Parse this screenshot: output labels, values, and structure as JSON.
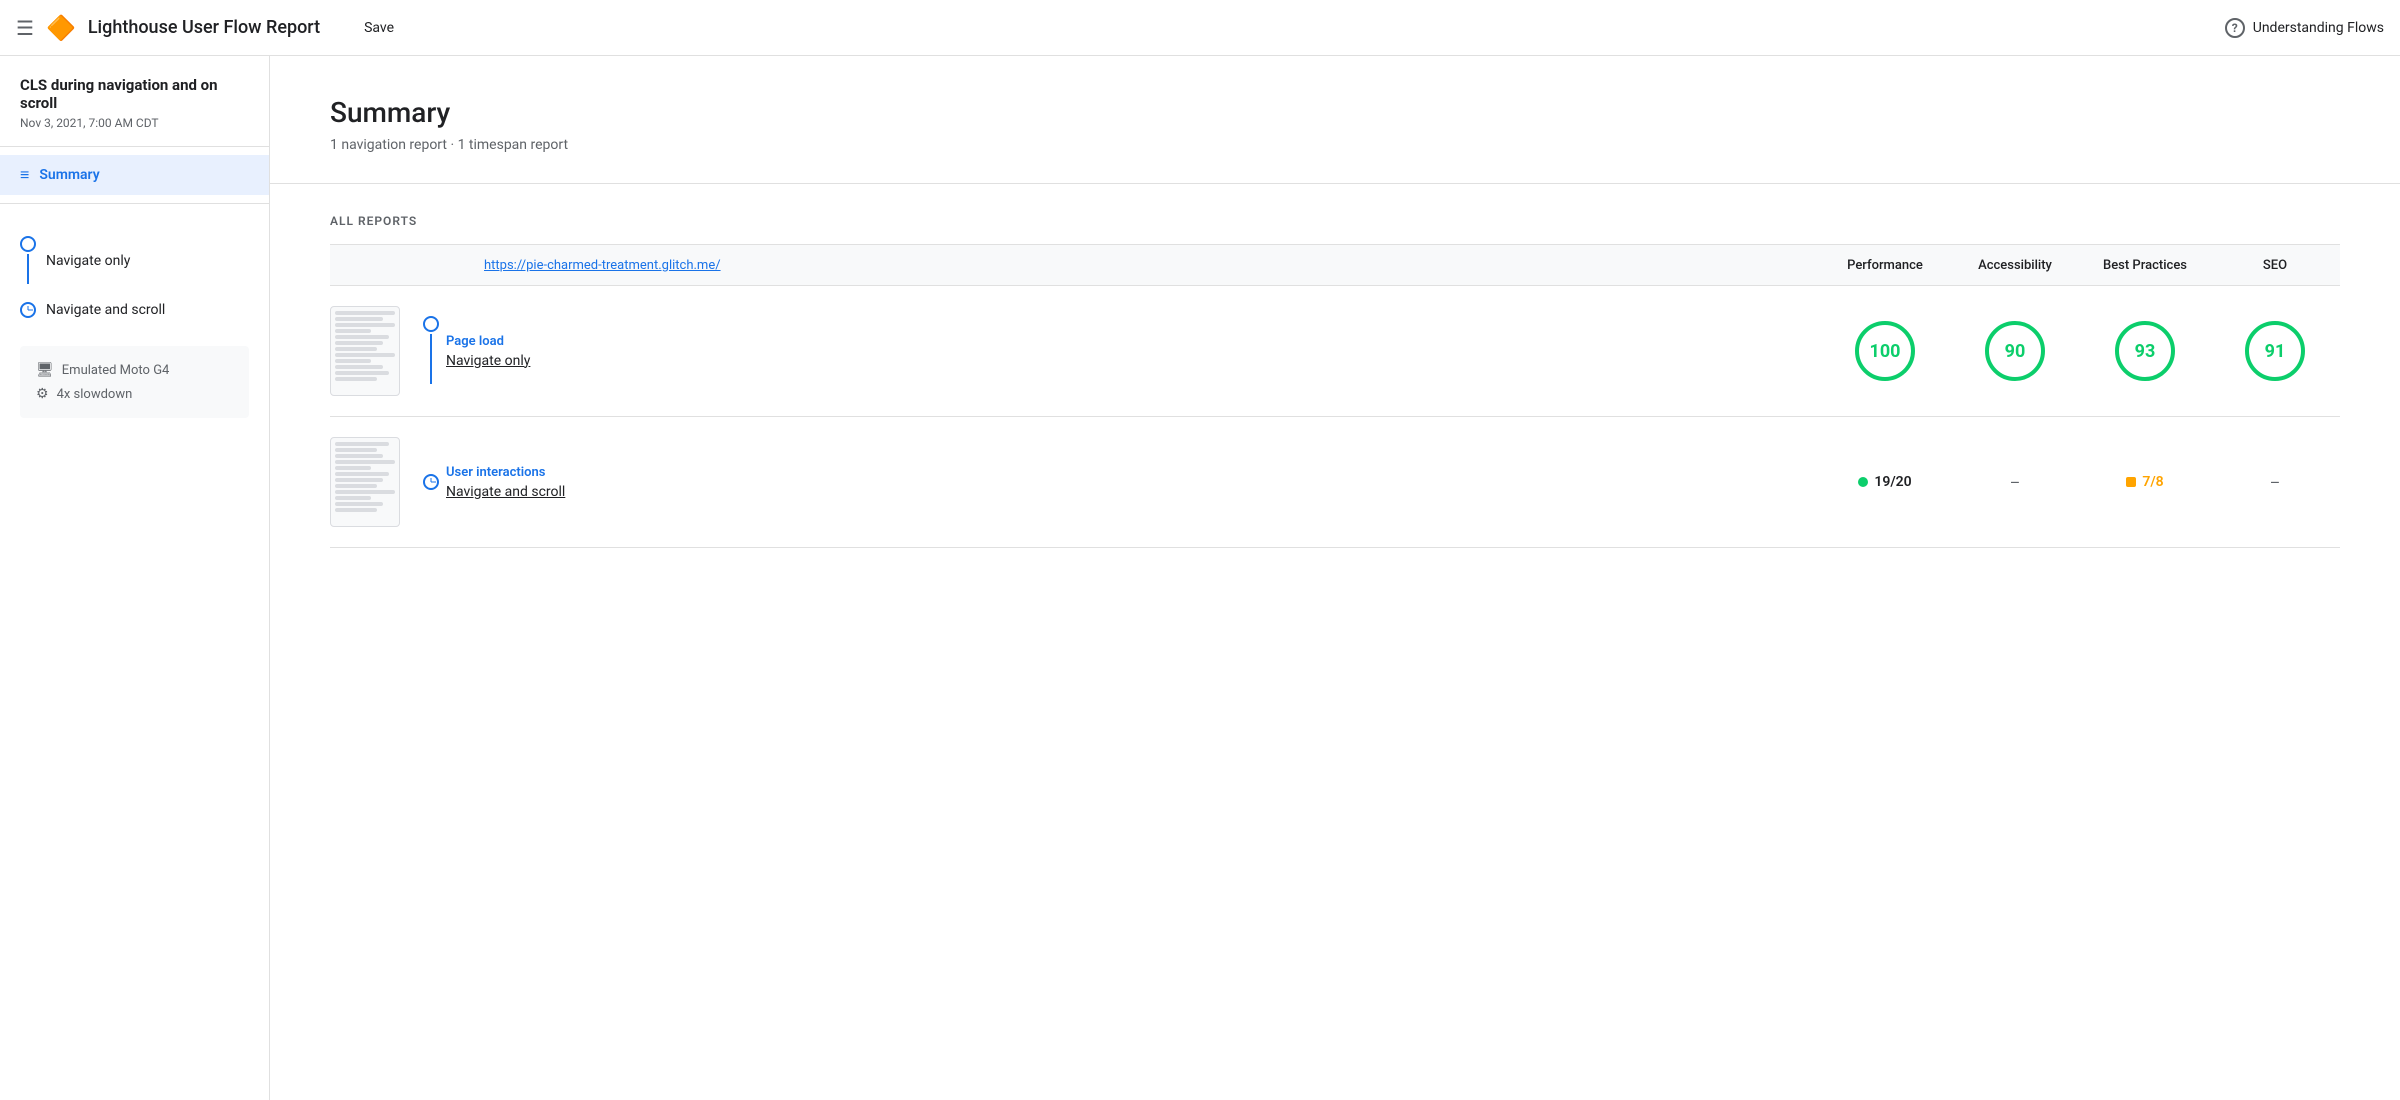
{
  "header": {
    "menu_icon": "☰",
    "logo_icon": "🔶",
    "title": "Lighthouse User Flow Report",
    "save_label": "Save",
    "help_label": "Understanding Flows"
  },
  "sidebar": {
    "project_title": "CLS during navigation and on scroll",
    "project_date": "Nov 3, 2021, 7:00 AM CDT",
    "summary_label": "Summary",
    "flows": [
      {
        "label": "Navigate only",
        "type": "circle"
      },
      {
        "label": "Navigate and scroll",
        "type": "clock"
      }
    ],
    "device": {
      "items": [
        {
          "icon": "🖥",
          "label": "Emulated Moto G4"
        },
        {
          "icon": "⚙",
          "label": "4x slowdown"
        }
      ]
    }
  },
  "main": {
    "summary": {
      "title": "Summary",
      "subtitle": "1 navigation report · 1 timespan report"
    },
    "all_reports": {
      "label": "ALL REPORTS",
      "url": "https://pie-charmed-treatment.glitch.me/",
      "columns": [
        "Performance",
        "Accessibility",
        "Best Practices",
        "SEO"
      ],
      "rows": [
        {
          "type": "Page load",
          "name": "Navigate only",
          "scores": [
            "100",
            "90",
            "93",
            "91"
          ],
          "score_type": "circle"
        },
        {
          "type": "User interactions",
          "name": "Navigate and scroll",
          "perf_score": "19/20",
          "access_score": "–",
          "best_score": "7/8",
          "seo_score": "–",
          "score_type": "timespan"
        }
      ]
    }
  }
}
